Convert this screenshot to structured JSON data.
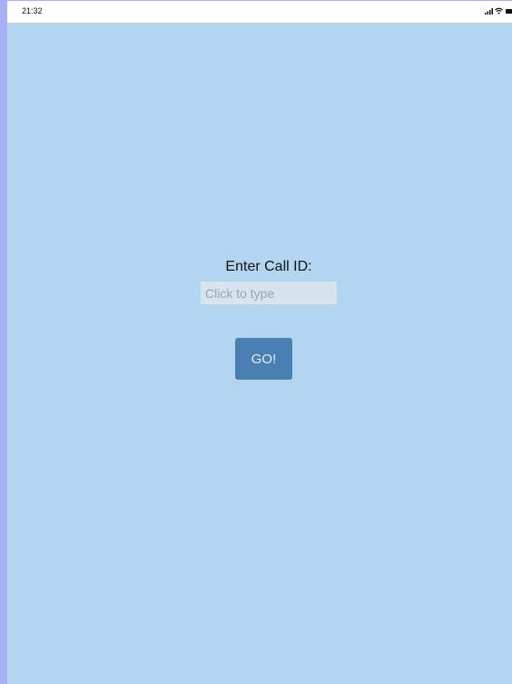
{
  "status_bar": {
    "time": "21:32",
    "icons": [
      "signal-icon",
      "wifi-icon",
      "battery-icon"
    ]
  },
  "form": {
    "prompt": "Enter Call ID:",
    "input_value": "",
    "input_placeholder": "Click to type",
    "go_label": "GO!"
  },
  "colors": {
    "background": "#b3d6f0",
    "left_edge": "#aab0f5",
    "input_background": "#d6e4ee",
    "button_background": "#4a7fb3",
    "button_text": "#e6eef6"
  }
}
